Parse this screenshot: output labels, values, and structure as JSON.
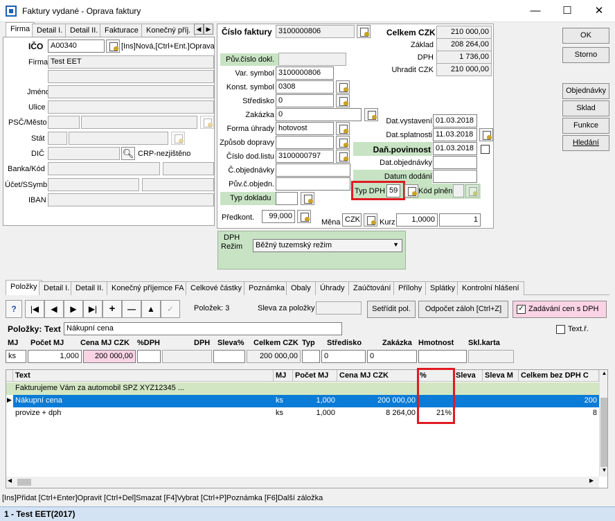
{
  "window": {
    "title": "Faktury vydané - Oprava faktury",
    "min": "—",
    "max": "☐",
    "close": "✕"
  },
  "left_tabs": [
    "Firma",
    "Detail I.",
    "Detail II.",
    "Fakturace",
    "Konečný příj."
  ],
  "firma": {
    "ico_label": "IČO",
    "ico": "A00340",
    "ico_hint": "[Ins]Nová,[Ctrl+Ent.]Oprava",
    "firma_label": "Firma",
    "firma": "Test EET",
    "jmeno_label": "Jméno",
    "ulice_label": "Ulice",
    "psc_label": "PSČ/Město",
    "stat_label": "Stát",
    "dic_label": "DIČ",
    "dic_hint": "CRP-nezjištěno",
    "banka_label": "Banka/Kód",
    "ucet_label": "Účet/SSymb",
    "iban_label": "IBAN"
  },
  "invoice": {
    "cislo_label": "Číslo faktury",
    "cislo": "3100000806",
    "puv_label": "Pův.číslo dokl.",
    "var_label": "Var. symbol",
    "var": "3100000806",
    "konst_label": "Konst. symbol",
    "konst": "0308",
    "stredisko_label": "Středisko",
    "stredisko": "0",
    "zakazka_label": "Zakázka",
    "zakazka": "0",
    "forma_label": "Forma úhrady",
    "forma": "hotovost",
    "zpusob_label": "Způsob dopravy",
    "dodlist_label": "Číslo dod.listu",
    "dodlist": "3100000797",
    "cobj_label": "Č.objednávky",
    "puvobj_label": "Pův.č.objedn.",
    "typdokl_label": "Typ dokladu",
    "predkont_label": "Předkont.",
    "predkont": "99,000",
    "mena_label": "Měna",
    "mena": "CZK",
    "kurz_label": "Kurz",
    "kurz": "1,0000",
    "kurz2": "1",
    "typdph_label": "Typ DPH",
    "typdph": "59",
    "kodplneni_label": "Kód plnění"
  },
  "totals": {
    "celkem_label": "Celkem CZK",
    "celkem": "210 000,00",
    "zaklad_label": "Základ",
    "zaklad": "208 264,00",
    "dph_label": "DPH",
    "dph": "1 736,00",
    "uhradit_label": "Uhradit CZK",
    "uhradit": "210 000,00"
  },
  "dates": {
    "vyst_label": "Dat.vystavení",
    "vyst": "01.03.2018",
    "splat_label": "Dat.splatnosti",
    "splat": "11.03.2018",
    "danpov_label": "Daň.povinnost",
    "danpov": "01.03.2018",
    "datobj_label": "Dat.objednávky",
    "datdod_label": "Datum dodání"
  },
  "dph_box": {
    "title": "DPH",
    "rezim_label": "Režim",
    "rezim": "Běžný tuzemský režim"
  },
  "side_buttons": [
    "OK",
    "Storno",
    "Objednávky",
    "Sklad",
    "Funkce",
    "Hledání"
  ],
  "bottom_tabs": [
    "Položky",
    "Detail I.",
    "Detail II.",
    "Konečný příjemce FA",
    "Celkové částky",
    "Poznámka",
    "Obaly",
    "Úhrady",
    "Zaúčtování",
    "Přílohy",
    "Splátky",
    "Kontrolní hlášení"
  ],
  "toolbar": {
    "polozek": "Položek:  3",
    "sleva_label": "Sleva za položky",
    "setridit": "Setřídit pol.",
    "odpocet": "Odpočet záloh [Ctrl+Z]",
    "zadavani": "Zadávání cen s DPH",
    "icons": [
      "?",
      "|◀",
      "◀",
      "▶",
      "▶|",
      "+",
      "—",
      "▲",
      "✓"
    ]
  },
  "item_edit": {
    "label": "Položky:",
    "text_label": "Text",
    "text": "Nákupní cena",
    "textr_label": "Text.ř.",
    "cols": [
      "MJ",
      "Počet MJ",
      "Cena MJ CZK",
      "%DPH",
      "DPH",
      "Sleva%",
      "Celkem CZK",
      "Typ",
      "Středisko",
      "Zakázka",
      "Hmotnost",
      "Skl.karta"
    ],
    "mj": "ks",
    "pocet": "1,000",
    "cena": "200 000,00",
    "celkem": "200 000,00",
    "stredisko": "0",
    "zakazka": "0"
  },
  "grid": {
    "headers": [
      "Text",
      "MJ",
      "Počet MJ",
      "Cena MJ CZK",
      "%",
      "Sleva",
      "Sleva M",
      "Celkem bez DPH C"
    ],
    "rows": [
      {
        "text": "Fakturujeme Vám za automobil SPZ  XYZ12345 ...",
        "mj": "",
        "pocet": "",
        "cena": "",
        "pct": "",
        "celkem": ""
      },
      {
        "text": "Nákupní cena",
        "mj": "ks",
        "pocet": "1,000",
        "cena": "200 000,00",
        "pct": "",
        "celkem": "200"
      },
      {
        "text": "provize + dph",
        "mj": "ks",
        "pocet": "1,000",
        "cena": "8 264,00",
        "pct": "21%",
        "celkem": "8"
      }
    ]
  },
  "status": "[Ins]Přidat [Ctrl+Enter]Opravit [Ctrl+Del]Smazat [F4]Vybrat [Ctrl+P]Poznámka [F6]Další záložka",
  "footer": "1 - Test EET(2017)"
}
